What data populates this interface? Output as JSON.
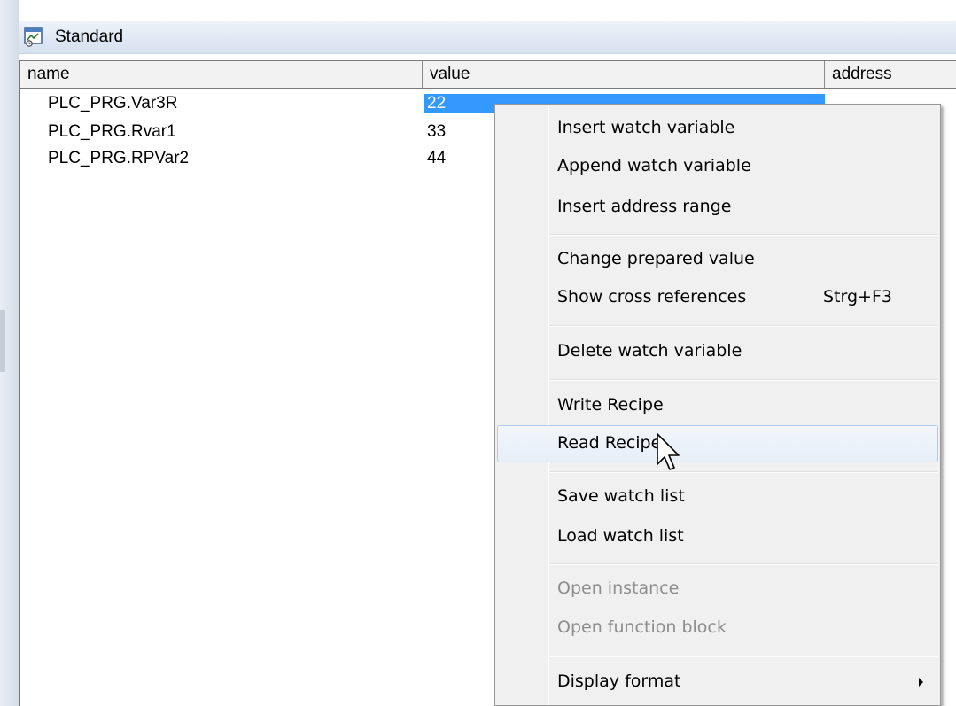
{
  "window": {
    "title": "Standard",
    "icon": "watch-list-icon"
  },
  "grid": {
    "columns": [
      "name",
      "value",
      "address"
    ],
    "rows": [
      {
        "name": "PLC_PRG.Var3R",
        "value": "22",
        "selected": true
      },
      {
        "name": "PLC_PRG.Rvar1",
        "value": "33",
        "selected": false
      },
      {
        "name": "PLC_PRG.RPVar2",
        "value": "44",
        "selected": false
      }
    ]
  },
  "menu": {
    "items": [
      {
        "label": "Insert watch variable"
      },
      {
        "label": "Append watch variable"
      },
      {
        "label": "Insert address range"
      },
      {
        "label": "Change prepared value"
      },
      {
        "label": "Show cross references",
        "shortcut": "Strg+F3"
      },
      {
        "label": "Delete watch variable"
      },
      {
        "label": "Write Recipe"
      },
      {
        "label": "Read Recipe",
        "hovered": true
      },
      {
        "label": "Save watch list"
      },
      {
        "label": "Load watch list"
      },
      {
        "label": "Open instance",
        "disabled": true
      },
      {
        "label": "Open function block",
        "disabled": true
      },
      {
        "label": "Display format",
        "submenu": true
      }
    ]
  },
  "colors": {
    "selection": "#3399ff",
    "hover_border": "#aecbee",
    "disabled_text": "#8d8d8d"
  }
}
